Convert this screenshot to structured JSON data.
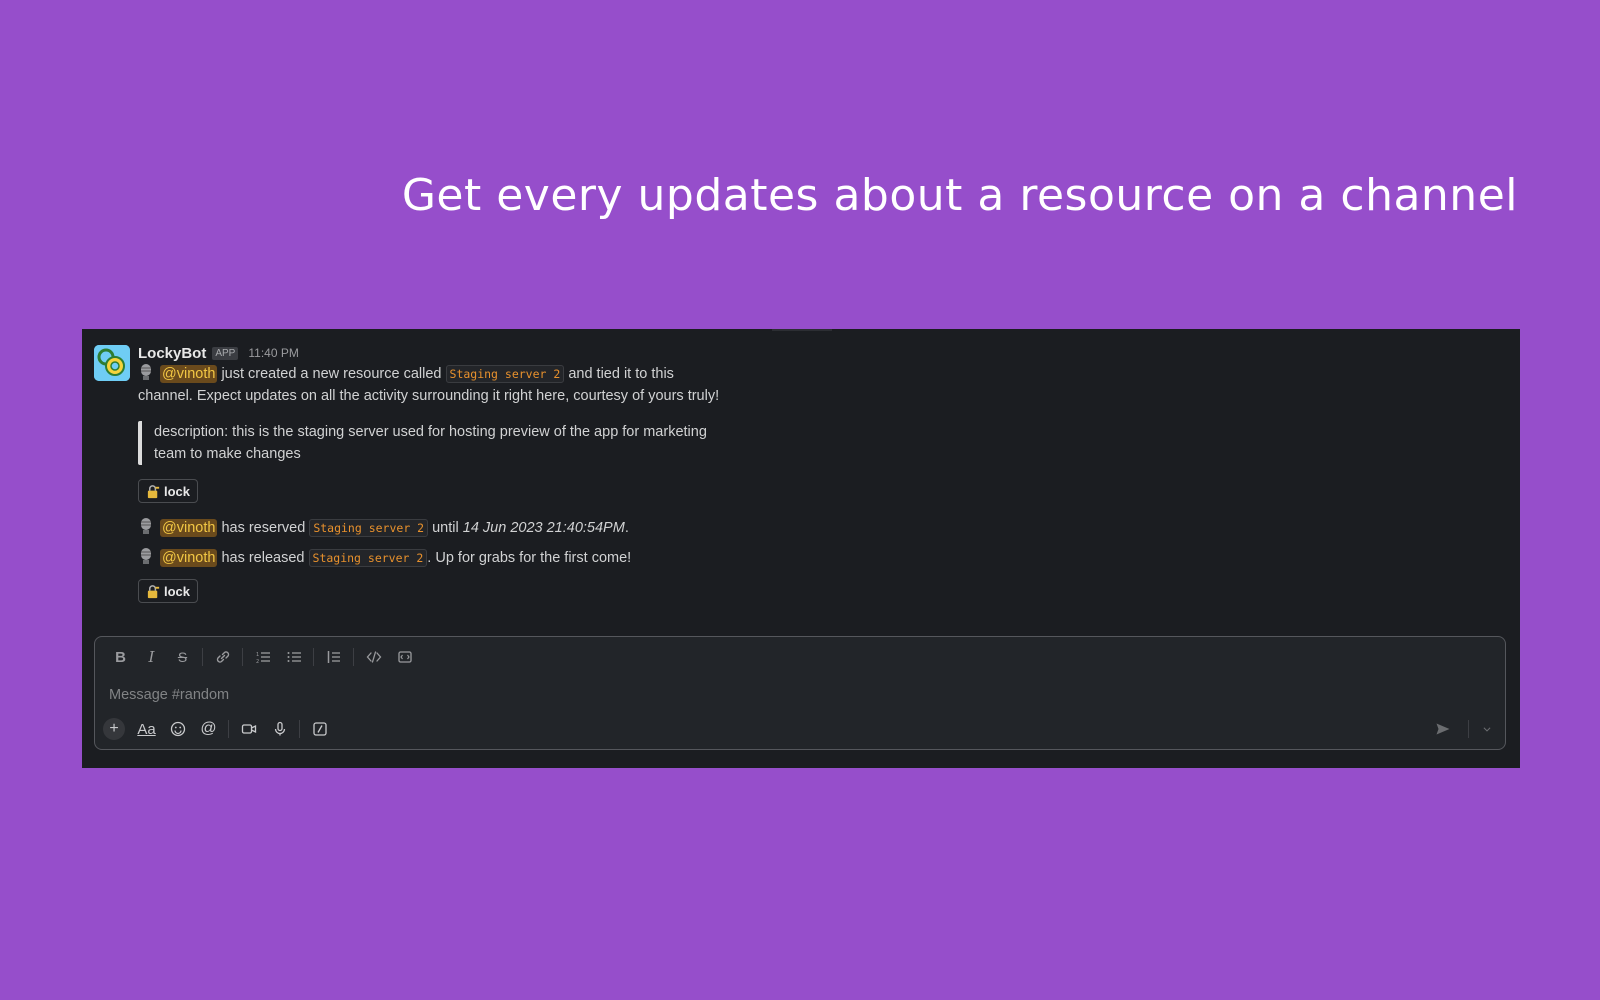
{
  "headline": "Get every updates about a resource on a channel",
  "message": {
    "bot_name": "LockyBot",
    "app_badge": "APP",
    "time": "11:40 PM",
    "created": {
      "mention": "@vinoth",
      "text_before_code": " just created a new resource called ",
      "resource": "Staging server 2",
      "text_after_code": " and tied it to this",
      "line2": "channel. Expect updates on all the activity surrounding it right here, courtesy of yours truly!"
    },
    "description": "description: this is the staging server used for hosting preview of the app for marketing team to make changes",
    "lock_button_1": "lock",
    "reserved": {
      "mention": "@vinoth",
      "text_before_code": " has reserved ",
      "resource": "Staging server 2",
      "text_after_code": " until ",
      "until_date": "14 Jun 2023 21:40:54PM",
      "text_end": "."
    },
    "released": {
      "mention": "@vinoth",
      "text_before_code": " has released ",
      "resource": "Staging server 2",
      "text_after_code": ". Up for grabs for the first come!"
    },
    "lock_button_2": "lock"
  },
  "composer": {
    "placeholder": "Message #random",
    "formatting_tools": [
      "bold-icon",
      "italic-icon",
      "strikethrough-icon",
      "link-icon",
      "ordered-list-icon",
      "bulleted-list-icon",
      "blockquote-icon",
      "code-icon",
      "code-block-icon"
    ],
    "action_tools": [
      "plus-icon",
      "text-format-icon",
      "emoji-icon",
      "mention-icon",
      "video-icon",
      "microphone-icon",
      "slash-command-icon"
    ],
    "send": "send-icon"
  },
  "colors": {
    "background": "#964ecb",
    "panel": "#1b1d21",
    "mention_bg": "#6a4a1c",
    "mention_text": "#f2c744",
    "code_text": "#e8912d"
  }
}
